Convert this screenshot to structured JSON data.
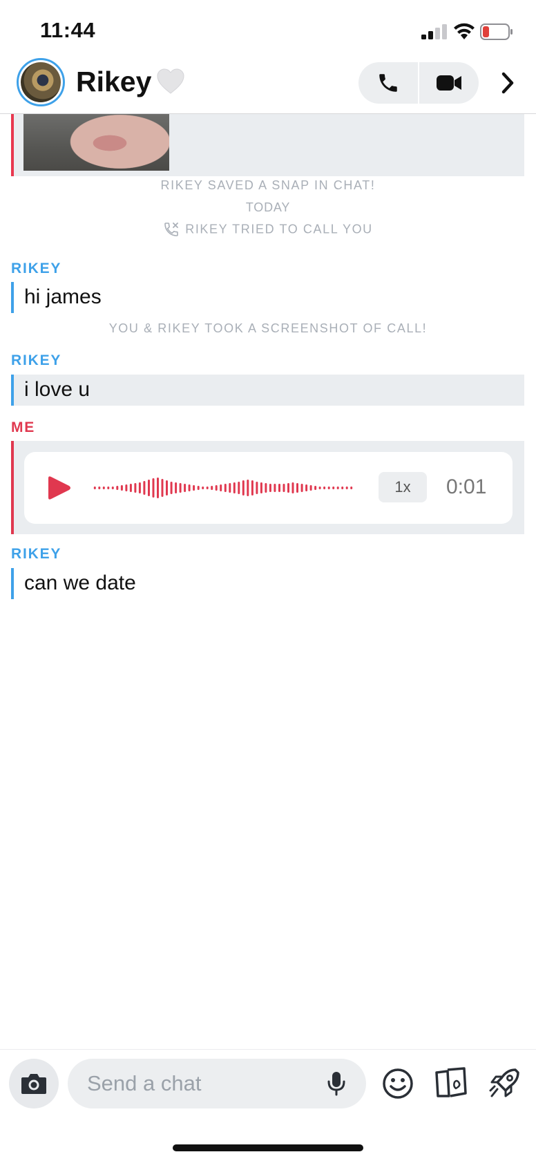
{
  "status_bar": {
    "time": "11:44",
    "signal_icon": "cellular-signal-icon",
    "wifi_icon": "wifi-icon",
    "battery_icon": "battery-low-icon",
    "battery_color": "#e0403a"
  },
  "header": {
    "contact_name": "Rikey",
    "heart_emoji": "🤍",
    "call_icon": "phone-icon",
    "video_icon": "video-camera-icon",
    "chevron_icon": "chevron-right-icon"
  },
  "conversation": {
    "system_saved": "RIKEY SAVED A SNAP IN CHAT!",
    "system_today": "TODAY",
    "system_call": "RIKEY TRIED TO CALL YOU",
    "system_screenshot": "YOU & RIKEY TOOK A SCREENSHOT OF CALL!",
    "messages": [
      {
        "sender": "RIKEY",
        "text": "hi james"
      },
      {
        "sender": "RIKEY",
        "text": "i love u"
      },
      {
        "sender": "ME",
        "type": "voice",
        "speed": "1x",
        "duration": "0:01"
      },
      {
        "sender": "RIKEY",
        "text": "can we date"
      }
    ]
  },
  "input_bar": {
    "placeholder": "Send a chat",
    "camera_icon": "camera-icon",
    "mic_icon": "microphone-icon",
    "emoji_icon": "emoji-icon",
    "cards_icon": "cards-icon",
    "rocket_icon": "rocket-icon"
  },
  "colors": {
    "friend_blue": "#3ea1e9",
    "me_red": "#e0384f",
    "bubble_gray": "#eaedf0",
    "system_text": "#a9afb7"
  }
}
